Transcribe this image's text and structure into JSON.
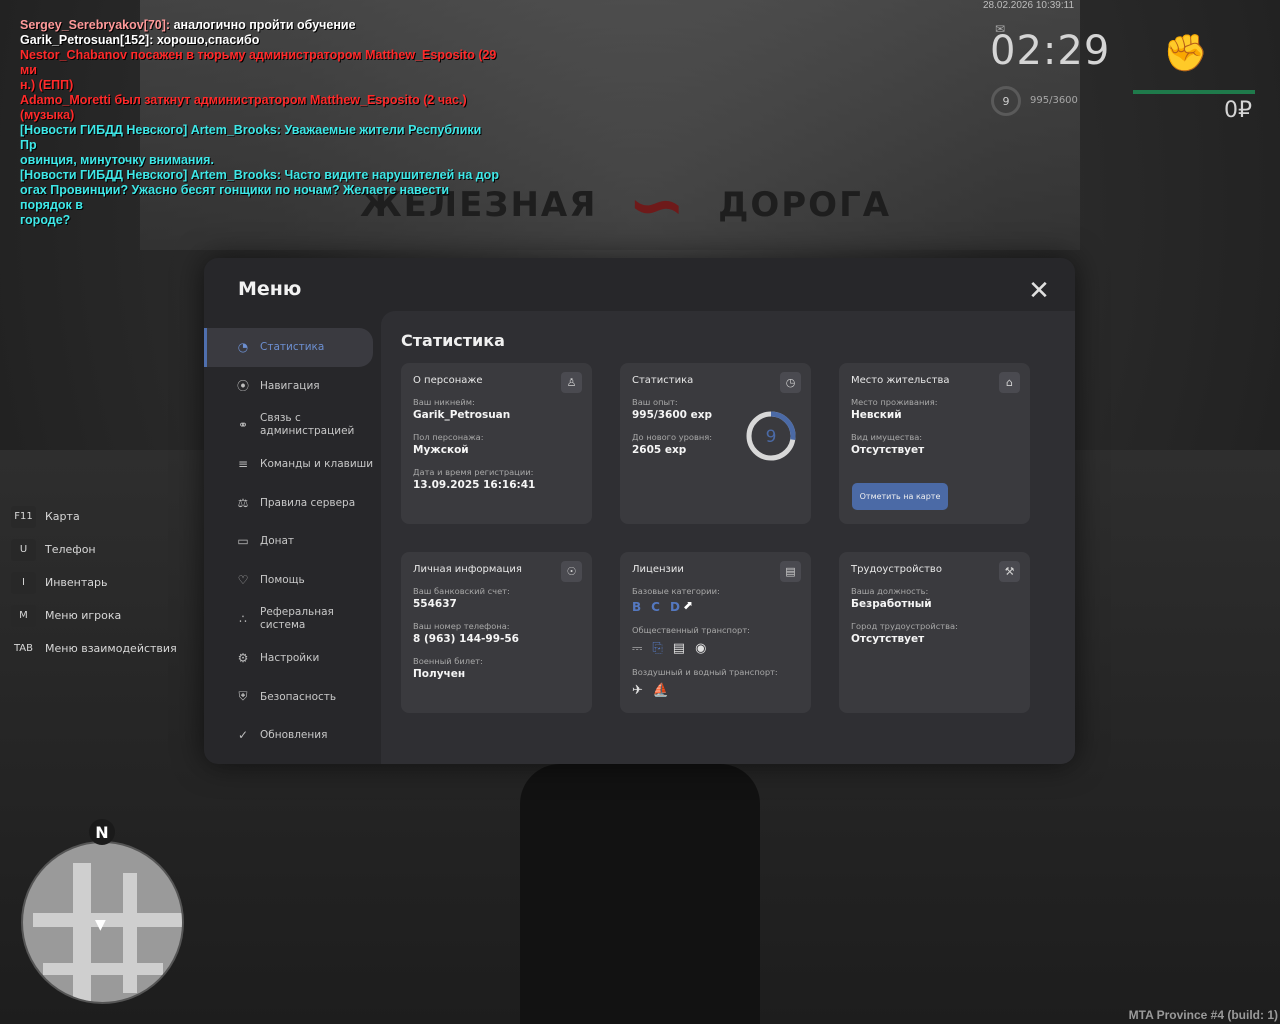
{
  "chat": [
    {
      "name": "Sergey_Serebryakov[70]:",
      "text": " аналогично пройти обучение",
      "type": "player-red"
    },
    {
      "name": "",
      "text": "Garik_Petrosuan[152]: хорошо,спасибо",
      "type": "white"
    },
    {
      "name": "",
      "text": "Nestor_Chabanov посажен в тюрьму администратором Matthew_Esposito (29 ми",
      "type": "red"
    },
    {
      "name": "",
      "text": "н.) (ЕПП)",
      "type": "red"
    },
    {
      "name": "",
      "text": "Adamo_Moretti был заткнут администратором Matthew_Esposito (2 час.) (музыка)",
      "type": "red"
    },
    {
      "name": "",
      "text": "[Новости ГИБДД Невского] Artem_Brooks: Уважаемые жители Республики Пр",
      "type": "cyan"
    },
    {
      "name": "",
      "text": "овинция, минуточку внимания.",
      "type": "cyan"
    },
    {
      "name": "",
      "text": "[Новости ГИБДД Невского] Artem_Brooks: Часто видите нарушителей на дор",
      "type": "cyan"
    },
    {
      "name": "",
      "text": "огах Провинции? Ужасно бесят гонщики по ночам? Желаете навести порядок в",
      "type": "cyan"
    },
    {
      "name": "",
      "text": " городе?",
      "type": "cyan"
    }
  ],
  "scene": {
    "sign_left": "ЖЕЛЕЗНАЯ",
    "sign_right": "ДОРОГА"
  },
  "hud": {
    "datetime": "28.02.2026 10:39:11",
    "time": "02:29",
    "level": "9",
    "exp": "995/3600",
    "money": "0₽"
  },
  "keys": [
    {
      "key": "F11",
      "label": "Карта"
    },
    {
      "key": "U",
      "label": "Телефон"
    },
    {
      "key": "I",
      "label": "Инвентарь"
    },
    {
      "key": "M",
      "label": "Меню игрока"
    },
    {
      "key": "TAB",
      "label": "Меню взаимодействия"
    }
  ],
  "minimap": {
    "north": "N"
  },
  "build": "MTA Province #4 (build: 1)",
  "menu": {
    "title": "Меню",
    "close_icon": "close-icon",
    "sidebar": [
      {
        "label": "Статистика",
        "icon": "pie-chart-icon",
        "active": true
      },
      {
        "label": "Навигация",
        "icon": "compass-icon"
      },
      {
        "label": "Связь с\nадминистрацией",
        "icon": "headset-icon"
      },
      {
        "label": "Команды и клавиши",
        "icon": "keyboard-icon"
      },
      {
        "label": "Правила сервера",
        "icon": "scales-icon"
      },
      {
        "label": "Донат",
        "icon": "wallet-icon"
      },
      {
        "label": "Помощь",
        "icon": "handshake-icon"
      },
      {
        "label": "Реферальная\nсистема",
        "icon": "network-icon"
      },
      {
        "label": "Настройки",
        "icon": "gear-icon"
      },
      {
        "label": "Безопасность",
        "icon": "shield-icon"
      },
      {
        "label": "Обновления",
        "icon": "refresh-check-icon"
      }
    ]
  },
  "stats": {
    "title": "Статистика",
    "character": {
      "title": "О персонаже",
      "nick_label": "Ваш никнейм:",
      "nick": "Garik_Petrosuan",
      "gender_label": "Пол персонажа:",
      "gender": "Мужской",
      "reg_label": "Дата и время регистрации:",
      "reg": "13.09.2025 16:16:41"
    },
    "statistics": {
      "title": "Статистика",
      "exp_label": "Ваш опыт:",
      "exp": "995/3600 exp",
      "next_label": "До нового уровня:",
      "next": "2605 exp",
      "level": "9",
      "progress": 0.276
    },
    "residence": {
      "title": "Место жительства",
      "place_label": "Место проживания:",
      "place": "Невский",
      "property_label": "Вид имущества:",
      "property": "Отсутствует",
      "map_button": "Отметить на карте"
    },
    "personal": {
      "title": "Личная информация",
      "bank_label": "Ваш банковский счет:",
      "bank": "554637",
      "phone_label": "Ваш номер телефона:",
      "phone": "8 (963) 144-99-56",
      "military_label": "Военный билет:",
      "military": "Получен"
    },
    "licenses": {
      "title": "Лицензии",
      "base_label": "Базовые категории:",
      "categories": [
        "B",
        "C",
        "D"
      ],
      "public_label": "Общественный транспорт:",
      "air_label": "Воздушный и водный транспорт:"
    },
    "employment": {
      "title": "Трудоустройство",
      "position_label": "Ваша должность:",
      "position": "Безработный",
      "city_label": "Город трудоустройства:",
      "city": "Отсутствует"
    }
  },
  "colors": {
    "accent": "#4b6aa6",
    "panel": "#27272a",
    "card": "#3a3a3e"
  }
}
